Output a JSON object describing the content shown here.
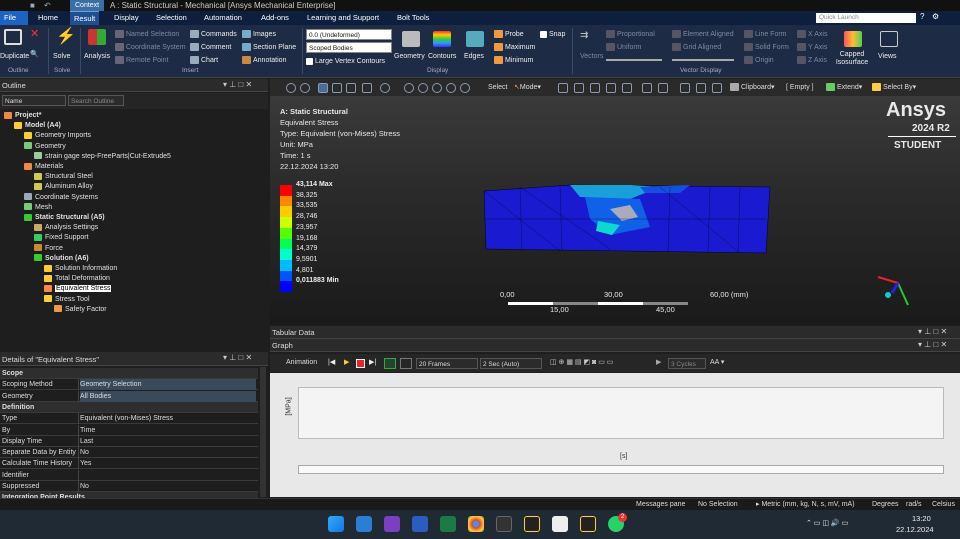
{
  "titlebar": {
    "context": "Context",
    "title": "A : Static Structural - Mechanical [Ansys Mechanical Enterprise]"
  },
  "menu": {
    "file": "File",
    "tabs": [
      "Home",
      "Result",
      "Display",
      "Selection",
      "Automation",
      "Add-ons",
      "Learning and Support",
      "Bolt Tools"
    ],
    "quick_launch": "Quick Launch"
  },
  "ribbon": {
    "duplicate": "Duplicate",
    "solve": "Solve",
    "analysis": "Analysis",
    "named_selection": "Named Selection",
    "coordinate_system": "Coordinate System",
    "remote_point": "Remote Point",
    "commands": "Commands",
    "comment": "Comment",
    "chart": "Chart",
    "images": "Images",
    "section_plane": "Section Plane",
    "annotation": "Annotation",
    "deformation_select": "0.0 (Undeformed)",
    "scope_select": "Scoped Bodies",
    "large_vertex": "Large Vertex Contours",
    "geometry": "Geometry",
    "contours": "Contours",
    "edges": "Edges",
    "probe": "Probe",
    "maximum": "Maximum",
    "minimum": "Minimum",
    "snap": "Snap",
    "vectors": "Vectors",
    "proportional": "Proportional",
    "uniform": "Uniform",
    "element_aligned": "Element Aligned",
    "grid_aligned": "Grid Aligned",
    "line_form": "Line Form",
    "solid_form": "Solid Form",
    "origin": "Origin",
    "x_axis": "X Axis",
    "y_axis": "Y Axis",
    "z_axis": "Z Axis",
    "capped": "Capped Isosurface",
    "views": "Views",
    "groups": {
      "outline": "Outline",
      "solve": "Solve",
      "insert": "Insert",
      "display": "Display",
      "vector_display": "Vector Display"
    }
  },
  "outline": {
    "title": "Outline",
    "name_label": "Name",
    "search_placeholder": "Search Outline",
    "tree": [
      "Project*",
      "Model (A4)",
      "Geometry Imports",
      "Geometry",
      "strain gage step-FreeParts|Cut-Extrude5",
      "Materials",
      "Structural Steel",
      "Aluminum Alloy",
      "Coordinate Systems",
      "Mesh",
      "Static Structural (A5)",
      "Analysis Settings",
      "Fixed Support",
      "Force",
      "Solution (A6)",
      "Solution Information",
      "Total Deformation",
      "Equivalent Stress",
      "Stress Tool",
      "Safety Factor"
    ]
  },
  "details": {
    "title": "Details of \"Equivalent Stress\"",
    "rows": [
      {
        "k": "Scope",
        "v": "",
        "sec": true
      },
      {
        "k": "Scoping Method",
        "v": "Geometry Selection"
      },
      {
        "k": "Geometry",
        "v": "All Bodies"
      },
      {
        "k": "Definition",
        "v": "",
        "sec": true
      },
      {
        "k": "Type",
        "v": "Equivalent (von-Mises) Stress"
      },
      {
        "k": "By",
        "v": "Time"
      },
      {
        "k": "Display Time",
        "v": "Last"
      },
      {
        "k": "Separate Data by Entity",
        "v": "No"
      },
      {
        "k": "Calculate Time History",
        "v": "Yes"
      },
      {
        "k": "Identifier",
        "v": ""
      },
      {
        "k": "Suppressed",
        "v": "No"
      },
      {
        "k": "Integration Point Results",
        "v": "",
        "sec": true
      }
    ]
  },
  "viewer_toolbar": {
    "select": "Select",
    "mode": "Mode",
    "clipboard": "Clipboard",
    "empty": "[ Empty ]",
    "extend": "Extend",
    "select_by": "Select By"
  },
  "viewport": {
    "result_title": "A: Static Structural",
    "result_name": "Equivalent Stress",
    "type": "Type: Equivalent (von-Mises) Stress",
    "unit": "Unit: MPa",
    "time": "Time: 1 s",
    "date": "22.12.2024 13:20",
    "brand": "Ansys",
    "version": "2024 R2",
    "edition": "STUDENT",
    "legend": [
      "43,114 Max",
      "38,325",
      "33,535",
      "28,746",
      "23,957",
      "19,168",
      "14,379",
      "9,5901",
      "4,801",
      "0,011883 Min"
    ],
    "legend_colors": [
      "#ff0000",
      "#ff8800",
      "#ffcc00",
      "#ccff00",
      "#55ff00",
      "#00ff55",
      "#00ffcc",
      "#00bbff",
      "#0055ff",
      "#0000ff"
    ],
    "scale_top": [
      "0,00",
      "30,00",
      "60,00 (mm)"
    ],
    "scale_bottom": [
      "15,00",
      "45,00"
    ]
  },
  "tabular": {
    "title": "Tabular Data"
  },
  "graph": {
    "title": "Graph",
    "animation": "Animation",
    "frames": "20 Frames",
    "duration": "2 Sec (Auto)",
    "cycles": "3 Cycles",
    "ylabel": "[MPa]",
    "xlabel": "[s]"
  },
  "status": {
    "messages": "Messages pane",
    "selection": "No Selection",
    "units": "Metric (mm, kg, N, s, mV, mA)",
    "degrees": "Degrees",
    "rads": "rad/s",
    "temp": "Celsius"
  },
  "taskbar": {
    "time": "13:20",
    "date": "22.12.2024",
    "whatsapp_badge": "2"
  }
}
